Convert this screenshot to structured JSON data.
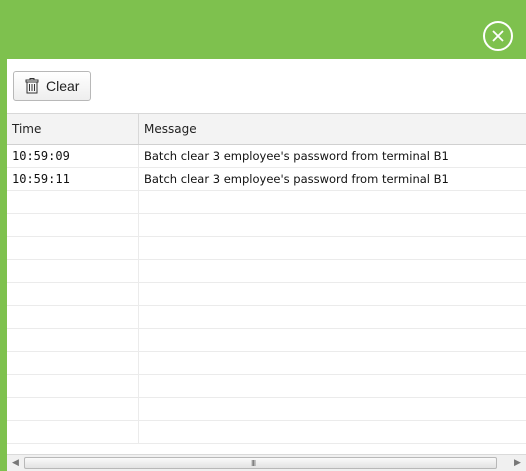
{
  "toolbar": {
    "clear_label": "Clear",
    "clear_icon": "trash-icon"
  },
  "grid": {
    "columns": [
      "Time",
      "Message"
    ],
    "rows": [
      {
        "time": "10:59:09",
        "message": "Batch clear 3 employee's password from terminal B1"
      },
      {
        "time": "10:59:11",
        "message": "Batch clear 3 employee's password from terminal B1"
      },
      {
        "time": "",
        "message": ""
      },
      {
        "time": "",
        "message": ""
      },
      {
        "time": "",
        "message": ""
      },
      {
        "time": "",
        "message": ""
      },
      {
        "time": "",
        "message": ""
      },
      {
        "time": "",
        "message": ""
      },
      {
        "time": "",
        "message": ""
      },
      {
        "time": "",
        "message": ""
      },
      {
        "time": "",
        "message": ""
      },
      {
        "time": "",
        "message": ""
      },
      {
        "time": "",
        "message": ""
      }
    ]
  },
  "scrollbar": {
    "grip": "III"
  },
  "colors": {
    "accent": "#7ec14e"
  }
}
